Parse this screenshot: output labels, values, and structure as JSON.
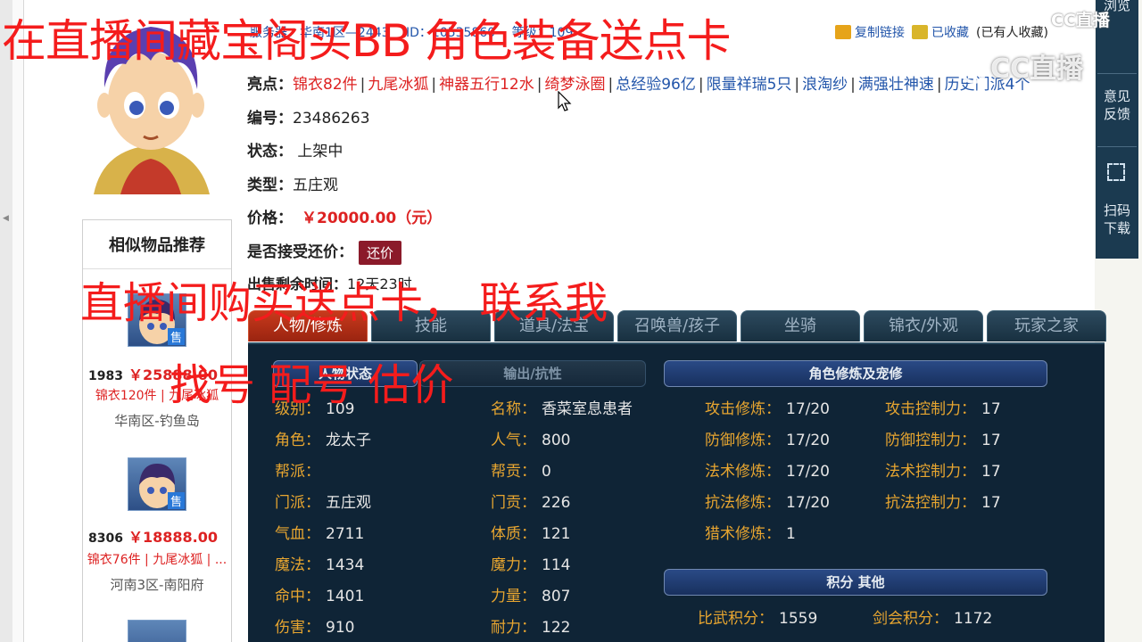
{
  "overlay": {
    "caption_top": "在直播间藏宝阁买BB 角色装备送点卡",
    "caption_mid": "直播间购买送点卡， 联系我",
    "caption_low": "找号 配号 估价"
  },
  "topbar": {
    "server_info": "服务器：华南1区—2443",
    "id_info": "ID：10535860",
    "grade_info": "等级：109",
    "copy_link": "复制链接",
    "favorited": "已收藏",
    "extra": "(已有人收藏)"
  },
  "item": {
    "highlights_label": "亮点：",
    "highlights": [
      {
        "text": "锦衣82件",
        "color": "red"
      },
      {
        "text": "九尾冰狐",
        "color": "red"
      },
      {
        "text": "神器五行12水",
        "color": "red"
      },
      {
        "text": "绮梦泳圈",
        "color": "red"
      },
      {
        "text": "总经验96亿",
        "color": "blue"
      },
      {
        "text": "限量祥瑞5只",
        "color": "blue"
      },
      {
        "text": "浪淘纱",
        "color": "blue"
      },
      {
        "text": "满强壮神速",
        "color": "blue"
      },
      {
        "text": "历史门派4个",
        "color": "blue"
      }
    ],
    "id_label": "编号：",
    "id_value": "23486263",
    "status_label": "状态：",
    "status_value": "上架中",
    "type_label": "类型：",
    "type_value": "五庄观",
    "price_label": "价格：",
    "price_value": "￥20000.00（元）",
    "bargain_label": "是否接受还价：",
    "bargain_button": "还价",
    "remain_label": "出售剩余时间：",
    "remain_value": "12天23时"
  },
  "similar": {
    "title": "相似物品推荐",
    "items": [
      {
        "no": "1983",
        "price": "￥25888.00",
        "tags": "锦衣120件 | 九尾冰狐",
        "server": "华南区-钓鱼岛",
        "tag": "售"
      },
      {
        "no": "8306",
        "price": "￥18888.00",
        "tags": "锦衣76件 | 九尾冰狐 | ...",
        "server": "河南3区-南阳府",
        "tag": "售"
      }
    ]
  },
  "tabs": [
    "人物/修炼",
    "技能",
    "道具/法宝",
    "召唤兽/孩子",
    "坐骑",
    "锦衣/外观",
    "玩家之家"
  ],
  "panel": {
    "left_header_1": "人物状态",
    "left_header_2": "输出/抗性",
    "right_header_1": "角色修炼及宠修",
    "right_header_2": "积分 其他",
    "stats_a": [
      {
        "k": "级别：",
        "v": "109"
      },
      {
        "k": "角色：",
        "v": "龙太子"
      },
      {
        "k": "帮派：",
        "v": ""
      },
      {
        "k": "门派：",
        "v": "五庄观"
      },
      {
        "k": "气血：",
        "v": "2711"
      },
      {
        "k": "魔法：",
        "v": "1434"
      },
      {
        "k": "命中：",
        "v": "1401"
      },
      {
        "k": "伤害：",
        "v": "910"
      }
    ],
    "stats_b": [
      {
        "k": "名称：",
        "v": "香菜室息患者"
      },
      {
        "k": "人气：",
        "v": "800"
      },
      {
        "k": "帮贡：",
        "v": "0"
      },
      {
        "k": "门贡：",
        "v": "226"
      },
      {
        "k": "体质：",
        "v": "121"
      },
      {
        "k": "魔力：",
        "v": "114"
      },
      {
        "k": "力量：",
        "v": "807"
      },
      {
        "k": "耐力：",
        "v": "122"
      }
    ],
    "cultivation_a": [
      {
        "k": "攻击修炼：",
        "v": "17/20"
      },
      {
        "k": "防御修炼：",
        "v": "17/20"
      },
      {
        "k": "法术修炼：",
        "v": "17/20"
      },
      {
        "k": "抗法修炼：",
        "v": "17/20"
      },
      {
        "k": "猎术修炼：",
        "v": "1"
      }
    ],
    "cultivation_b": [
      {
        "k": "攻击控制力：",
        "v": "17"
      },
      {
        "k": "防御控制力：",
        "v": "17"
      },
      {
        "k": "法术控制力：",
        "v": "17"
      },
      {
        "k": "抗法控制力：",
        "v": "17"
      }
    ],
    "scores": [
      {
        "k": "比武积分：",
        "v": "1559"
      },
      {
        "k": "剑会积分：",
        "v": "1172"
      }
    ]
  },
  "right_bar": {
    "browse": "浏览",
    "feedback_1": "意见",
    "feedback_2": "反馈",
    "scan_1": "扫码",
    "scan_2": "下载"
  },
  "watermark": {
    "logo": "CC直播",
    "large": "CC直播"
  }
}
